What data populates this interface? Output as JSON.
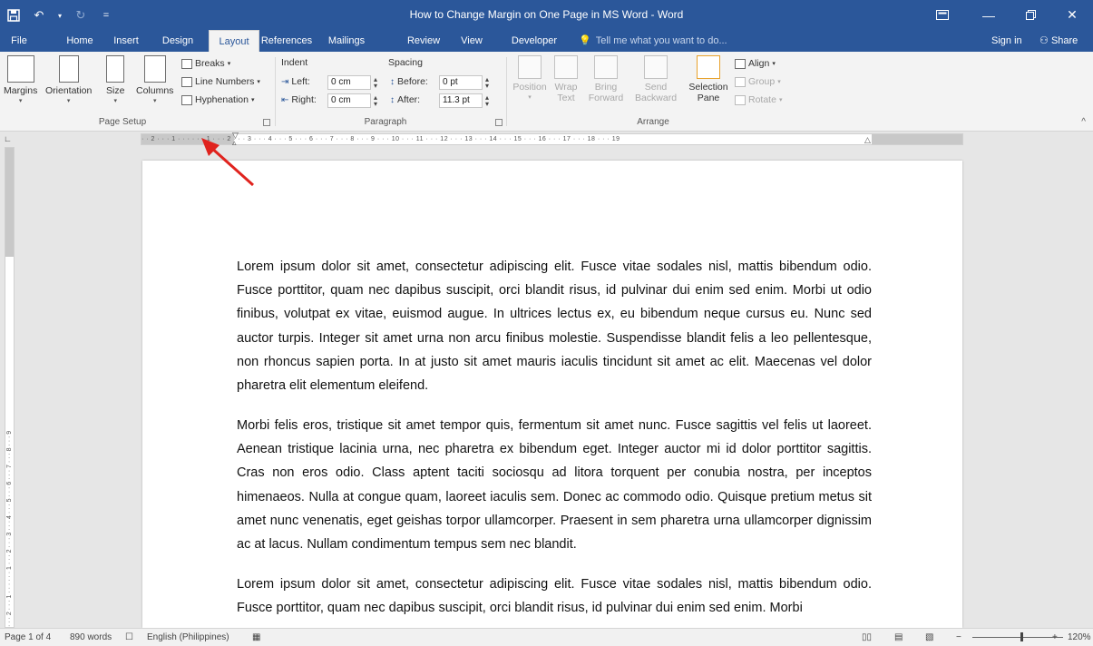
{
  "window": {
    "title": "How to Change Margin on One Page in MS Word - Word",
    "controls": [
      "ribbon-display-options",
      "minimize",
      "restore",
      "close"
    ]
  },
  "qat": {
    "save": "save-icon",
    "undo": "undo-icon",
    "redo": "redo-icon",
    "customize": "="
  },
  "tabs": [
    {
      "label": "File"
    },
    {
      "label": "Home"
    },
    {
      "label": "Insert"
    },
    {
      "label": "Design"
    },
    {
      "label": "Layout",
      "active": true
    },
    {
      "label": "References"
    },
    {
      "label": "Mailings"
    },
    {
      "label": "Review"
    },
    {
      "label": "View"
    },
    {
      "label": "Developer"
    }
  ],
  "tellme": "Tell me what you want to do...",
  "signin": "Sign in",
  "share": "Share",
  "ribbon": {
    "page_setup": {
      "label": "Page Setup",
      "margins": "Margins",
      "orientation": "Orientation",
      "size": "Size",
      "columns": "Columns",
      "breaks": "Breaks",
      "line_numbers": "Line Numbers",
      "hyphenation": "Hyphenation"
    },
    "paragraph": {
      "label": "Paragraph",
      "indent": "Indent",
      "spacing": "Spacing",
      "left": "Left:",
      "right": "Right:",
      "before": "Before:",
      "after": "After:",
      "left_value": "0 cm",
      "right_value": "0 cm",
      "before_value": "0 pt",
      "after_value": "11.3 pt"
    },
    "arrange": {
      "label": "Arrange",
      "position": "Position",
      "wrap_text_1": "Wrap",
      "wrap_text_2": "Text",
      "bring_forward_1": "Bring",
      "bring_forward_2": "Forward",
      "send_backward_1": "Send",
      "send_backward_2": "Backward",
      "selection_pane_1": "Selection",
      "selection_pane_2": "Pane",
      "align": "Align",
      "group": "Group",
      "rotate": "Rotate"
    }
  },
  "ruler": {
    "ticks": "· · 2 · · · 1 · · ·   · · · 1 · · · 2 · · · 3 · · · 4 · · · 5 · · · 6 · · · 7 · · · 8 · · · 9 · · · 10 · · · 11 · · · 12 · · · 13 · · · 14 · · · 15 · · · 16 · · · 17 · · · 18 · · · 19",
    "vticks": "· · · 2 · · · 1 · · · · · · 1 · · · 2 · · · 3 · · · 4 · · · 5 · · · 6 · · · 7 · · · 8 · · · 9"
  },
  "document": {
    "paragraphs": [
      "Lorem ipsum dolor sit amet, consectetur adipiscing elit. Fusce vitae sodales nisl, mattis bibendum odio. Fusce porttitor, quam nec dapibus suscipit, orci blandit risus, id pulvinar dui enim sed enim. Morbi ut odio finibus, volutpat ex vitae, euismod augue. In ultrices lectus ex, eu bibendum neque cursus eu. Nunc sed auctor turpis. Integer sit amet urna non arcu finibus molestie. Suspendisse blandit felis a leo pellentesque, non rhoncus sapien porta. In at justo sit amet mauris iaculis tincidunt sit amet ac elit. Maecenas vel dolor pharetra elit elementum eleifend.",
      "Morbi felis eros, tristique sit amet tempor quis, fermentum sit amet nunc. Fusce sagittis vel felis ut laoreet. Aenean tristique lacinia urna, nec pharetra ex bibendum eget. Integer auctor mi id dolor porttitor sagittis. Cras non eros odio. Class aptent taciti sociosqu ad litora torquent per conubia nostra, per inceptos himenaeos. Nulla at congue quam, laoreet iaculis sem. Donec ac commodo odio. Quisque pretium metus sit amet nunc venenatis, eget geishas torpor ullamcorper. Praesent in sem pharetra urna ullamcorper dignissim ac at lacus. Nullam condimentum tempus sem nec blandit.",
      "Lorem ipsum dolor sit amet, consectetur adipiscing elit. Fusce vitae sodales nisl, mattis bibendum odio. Fusce porttitor, quam nec dapibus suscipit, orci blandit risus, id pulvinar dui enim sed enim. Morbi"
    ]
  },
  "annotation": {
    "arrow_color": "#e0231e"
  },
  "status": {
    "page": "Page 1 of 4",
    "words": "890 words",
    "language": "English (Philippines)",
    "zoom": "120%"
  },
  "colors": {
    "accent": "#2b579a"
  }
}
